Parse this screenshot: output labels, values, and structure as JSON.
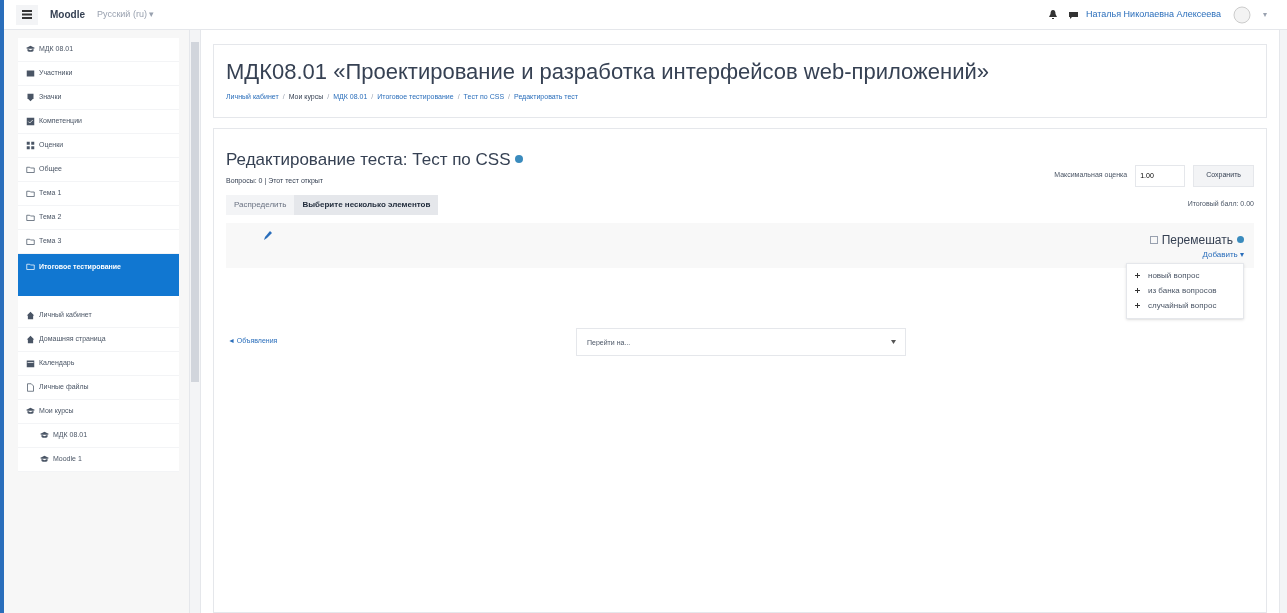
{
  "navbar": {
    "brand": "Moodle",
    "language": "Русский (ru) ▾",
    "user_name": "Наталья Николаевна Алексеева",
    "user_menu": "▾"
  },
  "sidebar": {
    "items": [
      {
        "label": "МДК 08.01",
        "selected": false
      },
      {
        "label": "Участники",
        "selected": false
      },
      {
        "label": "Значки",
        "selected": false
      },
      {
        "label": "Компетенции",
        "selected": false
      },
      {
        "label": "Оценки",
        "selected": false
      },
      {
        "label": "Общее",
        "selected": false
      },
      {
        "label": "Тема 1",
        "selected": false
      },
      {
        "label": "Тема 2",
        "selected": false
      },
      {
        "label": "Тема 3",
        "selected": false
      },
      {
        "label": "Итоговое тестирование",
        "selected": true
      },
      {
        "label": "Личный кабинет",
        "selected": false
      },
      {
        "label": "Домашняя страница",
        "selected": false
      },
      {
        "label": "Календарь",
        "selected": false
      },
      {
        "label": "Личные файлы",
        "selected": false
      },
      {
        "label": "Мои курсы",
        "selected": false,
        "children": [
          {
            "label": "МДК 08.01",
            "selected": false
          },
          {
            "label": "Moodle 1",
            "selected": false
          }
        ]
      }
    ]
  },
  "header": {
    "title": "МДК08.01 «Проектирование и разработка интерфейсов web-приложений»",
    "breadcrumbs": [
      {
        "label": "Личный кабинет",
        "kind": "link"
      },
      {
        "separator": "/",
        "label": "Мои курсы",
        "kind": "text"
      },
      {
        "separator": "/",
        "label": "МДК 08.01",
        "kind": "link"
      },
      {
        "separator": "/",
        "label": "Итоговое тестирование",
        "kind": "link"
      },
      {
        "separator": "/",
        "label": "Тест по CSS",
        "kind": "link"
      },
      {
        "separator": "/",
        "label": "Редактировать тест",
        "kind": "link"
      }
    ]
  },
  "editor": {
    "title": "Редактирование теста: Тест по CSS",
    "info": "Вопросы: 0 | Этот тест открыт",
    "max_grade_label": "Максимальная оценка",
    "max_grade": "1.00",
    "save_button": "Сохранить",
    "tabs": [
      {
        "label": "Распределить",
        "selected": false
      },
      {
        "label": "Выберите несколько элементов",
        "selected": true
      }
    ],
    "total": "Итоговый балл: 0.00",
    "shuffle": {
      "label": "Перемешать",
      "checked": false
    },
    "add": "Добавить ▾",
    "add_menu": [
      "новый вопрос",
      "из банка вопросов",
      "случайный вопрос"
    ]
  },
  "footer": {
    "prev_link": "◄ Объявления",
    "jump_placeholder": "Перейти на..."
  }
}
